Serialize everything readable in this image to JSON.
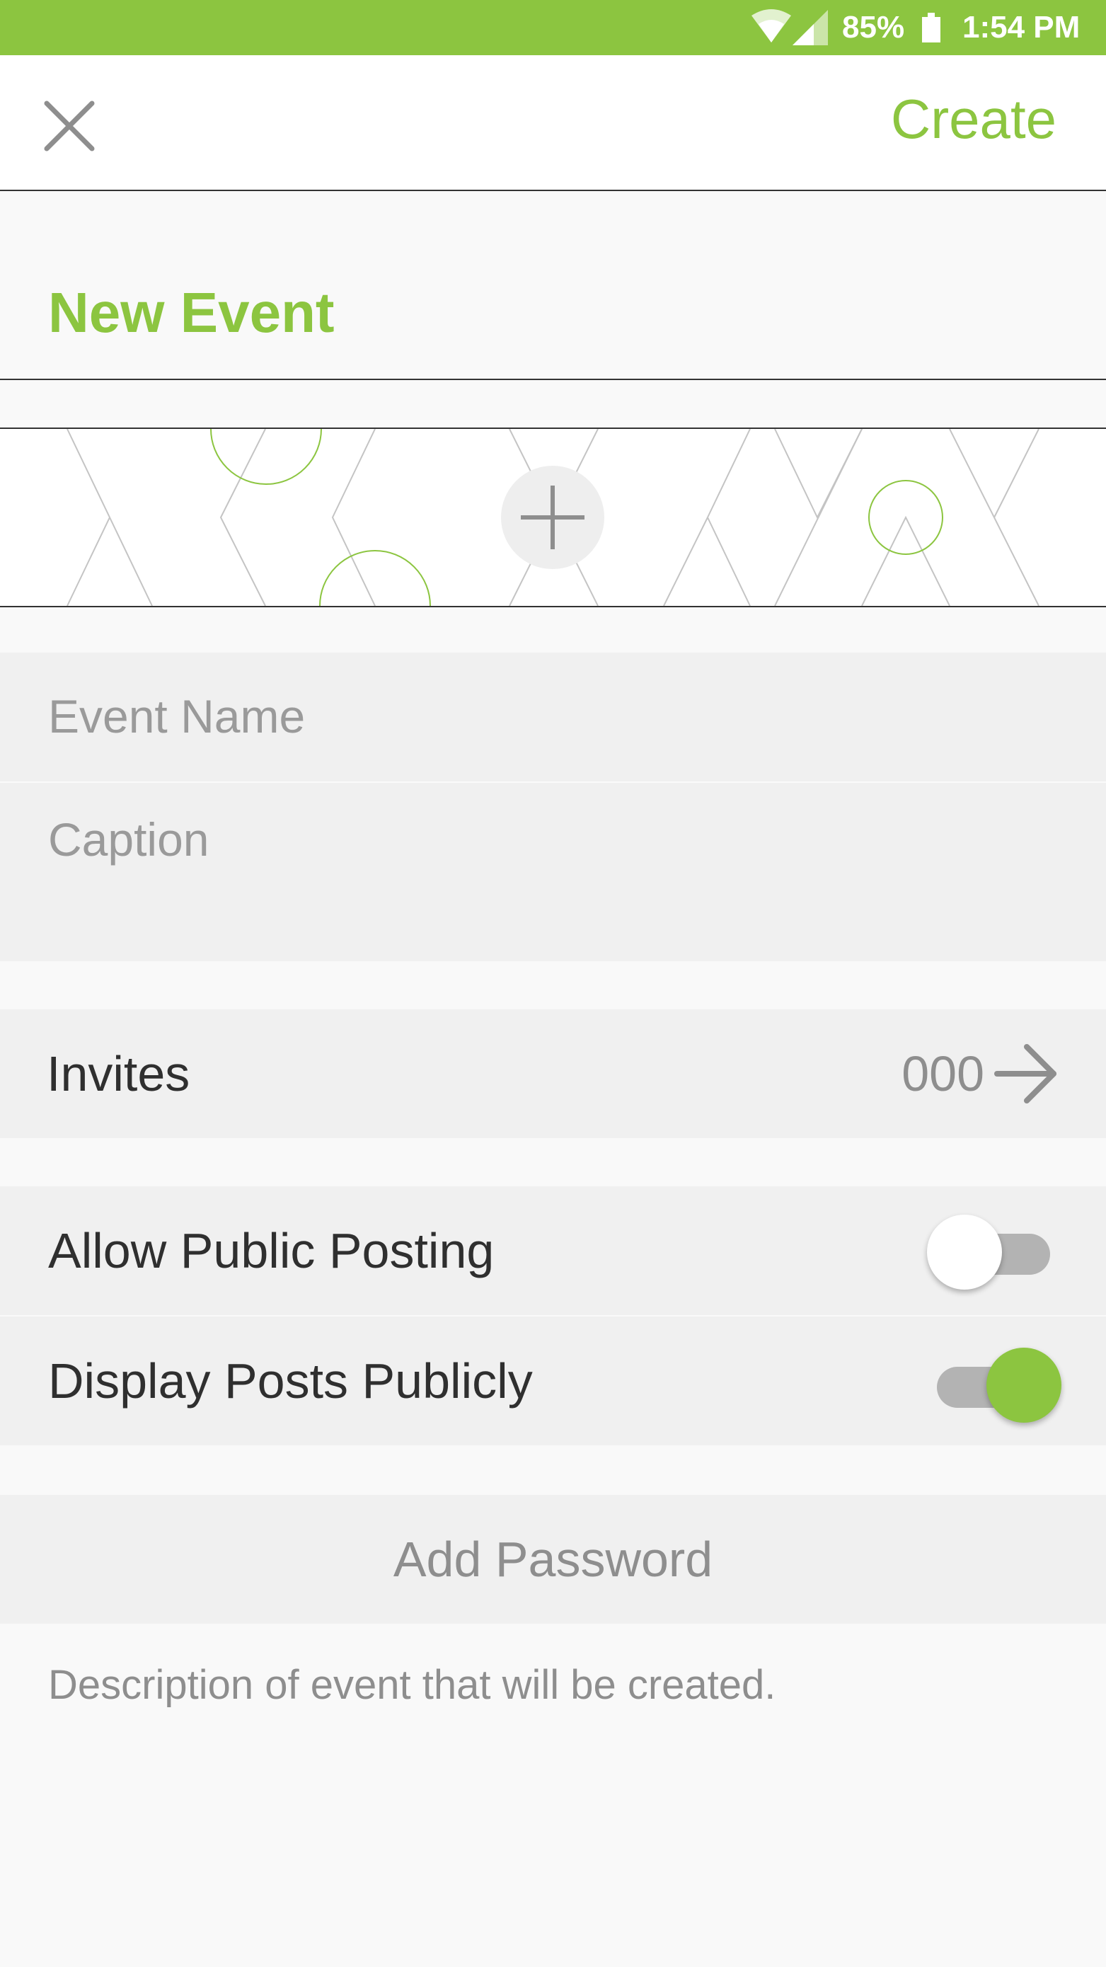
{
  "status_bar": {
    "battery_percent": "85%",
    "time": "1:54 PM",
    "icons": [
      "wifi-icon",
      "cell-signal-icon",
      "battery-icon"
    ]
  },
  "header": {
    "close_icon": "close-icon",
    "create_label": "Create"
  },
  "title": "New Event",
  "cover": {
    "add_icon": "plus-icon"
  },
  "form": {
    "event_name_placeholder": "Event Name",
    "caption_placeholder": "Caption"
  },
  "invites": {
    "label": "Invites",
    "count": "000",
    "arrow_icon": "arrow-right-icon"
  },
  "toggles": {
    "public_posting": {
      "label": "Allow Public Posting",
      "on": false
    },
    "display_posts": {
      "label": "Display Posts Publicly",
      "on": true
    }
  },
  "add_password_label": "Add Password",
  "description": "Description of event that will be created.",
  "colors": {
    "accent": "#8cc540",
    "field_background": "#f0f0f0",
    "placeholder_text": "#9a9a9a",
    "body_text": "#2f2f2f"
  }
}
